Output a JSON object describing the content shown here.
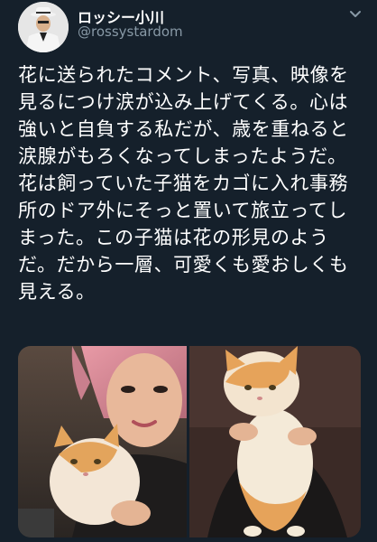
{
  "tweet": {
    "author": {
      "display_name": "ロッシー小川",
      "username": "@rossystardom",
      "avatar_icon": "profile-photo-icon"
    },
    "more_icon": "chevron-down-icon",
    "text": "花に送られたコメント、写真、映像を\n見るにつけ涙が込み上げてくる。心は\n強いと自負する私だが、歳を重ねると\n涙腺がもろくなってしまったようだ。\n花は飼っていた子猫をカゴに入れ事務\n所のドア外にそっと置いて旅立ってし\nまった。この子猫は花の形見のよう\nだ。だから一層、可愛くも愛おしくも\n見える。",
    "media": [
      {
        "name": "photo-woman-with-kitten"
      },
      {
        "name": "photo-kitten-held-up"
      }
    ]
  },
  "colors": {
    "background": "#15202b",
    "text": "#ffffff",
    "secondary_text": "#8899a6"
  }
}
